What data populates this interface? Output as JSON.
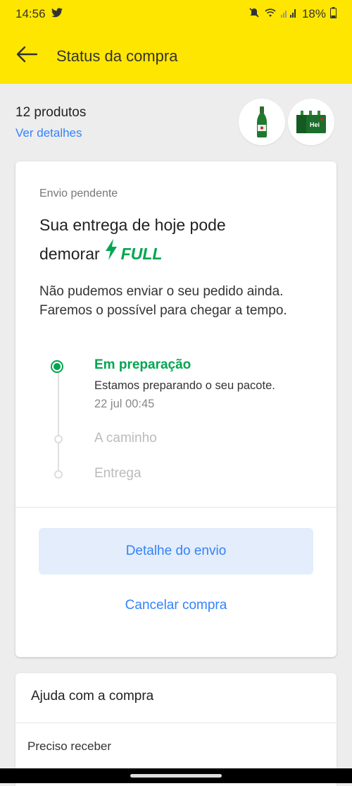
{
  "status_bar": {
    "time": "14:56",
    "battery": "18%",
    "icons": [
      "twitter-icon",
      "mute-icon",
      "wifi-icon",
      "signal-icon",
      "battery-icon"
    ]
  },
  "app_bar": {
    "title": "Status da compra",
    "back_icon": "arrow-left-icon"
  },
  "summary": {
    "products_count": "12 produtos",
    "details_link": "Ver detalhes",
    "thumbnails": [
      "beer-bottle",
      "beer-pack"
    ]
  },
  "shipment_card": {
    "status": "Envio pendente",
    "title_line1": "Sua entrega de hoje pode",
    "title_line2": "demorar",
    "full_label": "FULL",
    "description": "Não pudemos enviar o seu pedido ainda. Faremos o possível para chegar a tempo.",
    "timeline": [
      {
        "label": "Em preparação",
        "description": "Estamos preparando o seu pacote.",
        "time": "22 jul 00:45",
        "state": "active"
      },
      {
        "label": "A caminho",
        "state": "pending"
      },
      {
        "label": "Entrega",
        "state": "pending"
      }
    ],
    "primary_button": "Detalhe do envio",
    "secondary_button": "Cancelar compra"
  },
  "help": {
    "title": "Ajuda com a compra",
    "items": [
      "Preciso receber"
    ]
  },
  "colors": {
    "brand_yellow": "#ffe600",
    "accent_blue": "#3483fa",
    "success_green": "#00a650"
  }
}
